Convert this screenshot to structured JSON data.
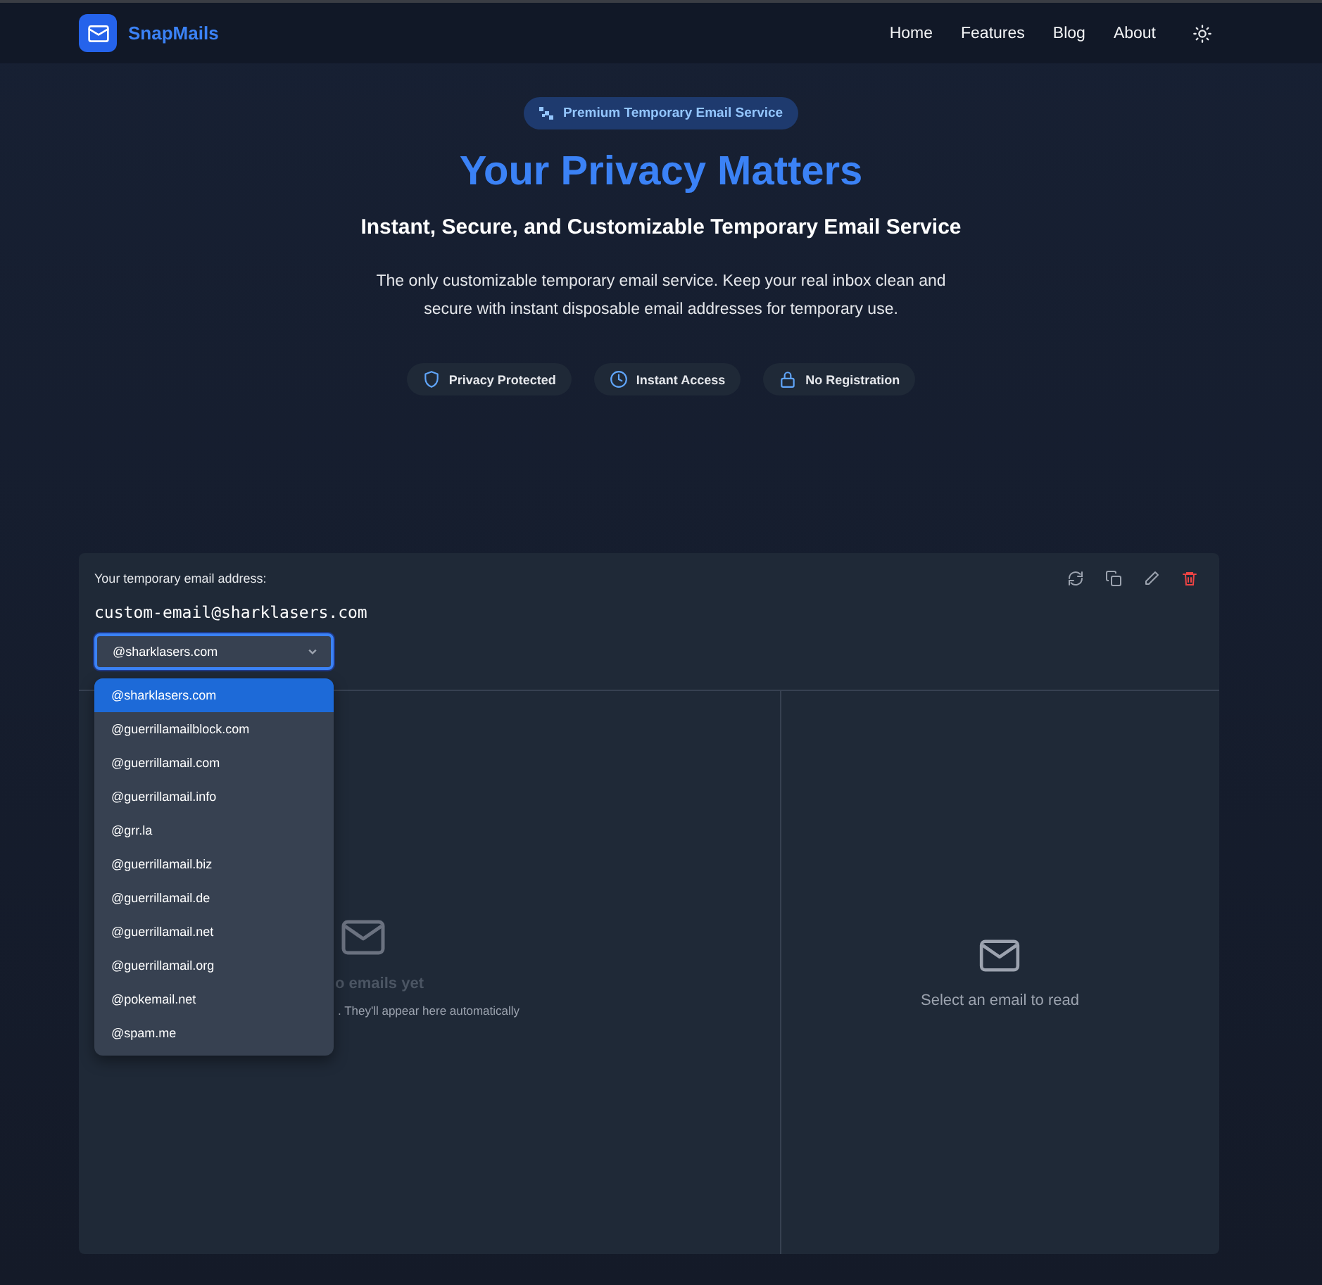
{
  "nav": {
    "brand": "SnapMails",
    "links": [
      "Home",
      "Features",
      "Blog",
      "About"
    ]
  },
  "hero": {
    "badge": "Premium Temporary Email Service",
    "title": "Your Privacy Matters",
    "subtitle": "Instant, Secure, and Customizable Temporary Email Service",
    "description": "The only customizable temporary email service. Keep your real inbox clean and secure with instant disposable email addresses for temporary use.",
    "features": [
      {
        "kind": "shield",
        "label": "Privacy Protected"
      },
      {
        "kind": "clock",
        "label": "Instant Access"
      },
      {
        "kind": "lock",
        "label": "No Registration"
      }
    ]
  },
  "mailbox": {
    "label": "Your temporary email address:",
    "address": "custom-email@sharklasers.com",
    "domain_select": {
      "value": "@sharklasers.com",
      "expanded": true,
      "options": [
        {
          "label": "@sharklasers.com",
          "selected": true
        },
        {
          "label": "@guerrillamailblock.com",
          "selected": false
        },
        {
          "label": "@guerrillamail.com",
          "selected": false
        },
        {
          "label": "@guerrillamail.info",
          "selected": false
        },
        {
          "label": "@grr.la",
          "selected": false
        },
        {
          "label": "@guerrillamail.biz",
          "selected": false
        },
        {
          "label": "@guerrillamail.de",
          "selected": false
        },
        {
          "label": "@guerrillamail.net",
          "selected": false
        },
        {
          "label": "@guerrillamail.org",
          "selected": false
        },
        {
          "label": "@pokemail.net",
          "selected": false
        },
        {
          "label": "@spam.me",
          "selected": false
        }
      ]
    },
    "inbox": {
      "empty_title": "o emails yet",
      "empty_hint": ". They'll appear here automatically"
    },
    "reader": {
      "empty_text": "Select an email to read"
    }
  }
}
